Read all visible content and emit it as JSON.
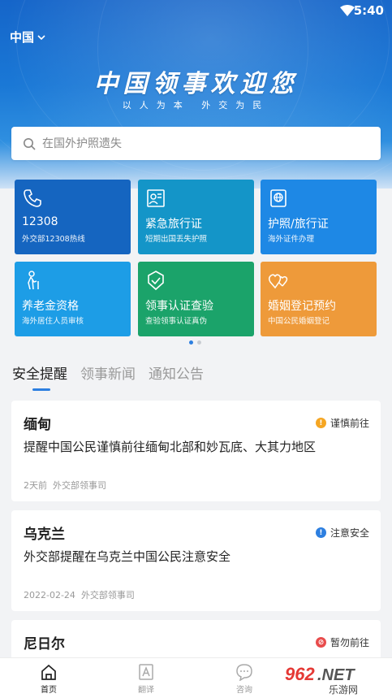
{
  "status_bar": {
    "time": "5:40"
  },
  "header": {
    "region": "中国",
    "banner_title": "中国领事欢迎您",
    "banner_subtitle": "以人为本 外交为民"
  },
  "search": {
    "placeholder": "在国外护照遗失"
  },
  "tiles": [
    {
      "title": "12308",
      "subtitle": "外交部12308热线",
      "color": "#1565c0",
      "icon": "phone-icon"
    },
    {
      "title": "紧急旅行证",
      "subtitle": "短期出国丢失护照",
      "color": "#1495c8",
      "icon": "id-card-icon"
    },
    {
      "title": "护照/旅行证",
      "subtitle": "海外证件办理",
      "color": "#1e88e5",
      "icon": "passport-icon"
    },
    {
      "title": "养老金资格",
      "subtitle": "海外居住人员审核",
      "color": "#1d9de6",
      "icon": "elder-icon"
    },
    {
      "title": "领事认证查验",
      "subtitle": "查验领事认证真伪",
      "color": "#1ba36a",
      "icon": "check-shield-icon"
    },
    {
      "title": "婚姻登记预约",
      "subtitle": "中国公民婚姻登记",
      "color": "#ee9a3a",
      "icon": "hearts-icon"
    }
  ],
  "tabs": [
    {
      "label": "安全提醒",
      "active": true
    },
    {
      "label": "领事新闻",
      "active": false
    },
    {
      "label": "通知公告",
      "active": false
    }
  ],
  "cards": [
    {
      "title": "缅甸",
      "badge": "谨慎前往",
      "badge_color": "#f5a623",
      "badge_glyph": "!",
      "body": "提醒中国公民谨慎前往缅甸北部和妙瓦底、大其力地区",
      "date": "2天前",
      "source": "外交部领事司"
    },
    {
      "title": "乌克兰",
      "badge": "注意安全",
      "badge_color": "#2d7fe0",
      "badge_glyph": "!",
      "body": "外交部提醒在乌克兰中国公民注意安全",
      "date": "2022-02-24",
      "source": "外交部领事司"
    },
    {
      "title": "尼日尔",
      "badge": "暂勿前往",
      "badge_color": "#e84c4c",
      "badge_glyph": "⊘"
    }
  ],
  "bottom_nav": [
    {
      "label": "首页",
      "icon": "home-icon",
      "active": true
    },
    {
      "label": "翻译",
      "icon": "translate-icon",
      "active": false
    },
    {
      "label": "咨询",
      "icon": "chat-icon",
      "active": false
    }
  ],
  "watermark": {
    "text": "962.NET",
    "subtext": "乐游网"
  }
}
